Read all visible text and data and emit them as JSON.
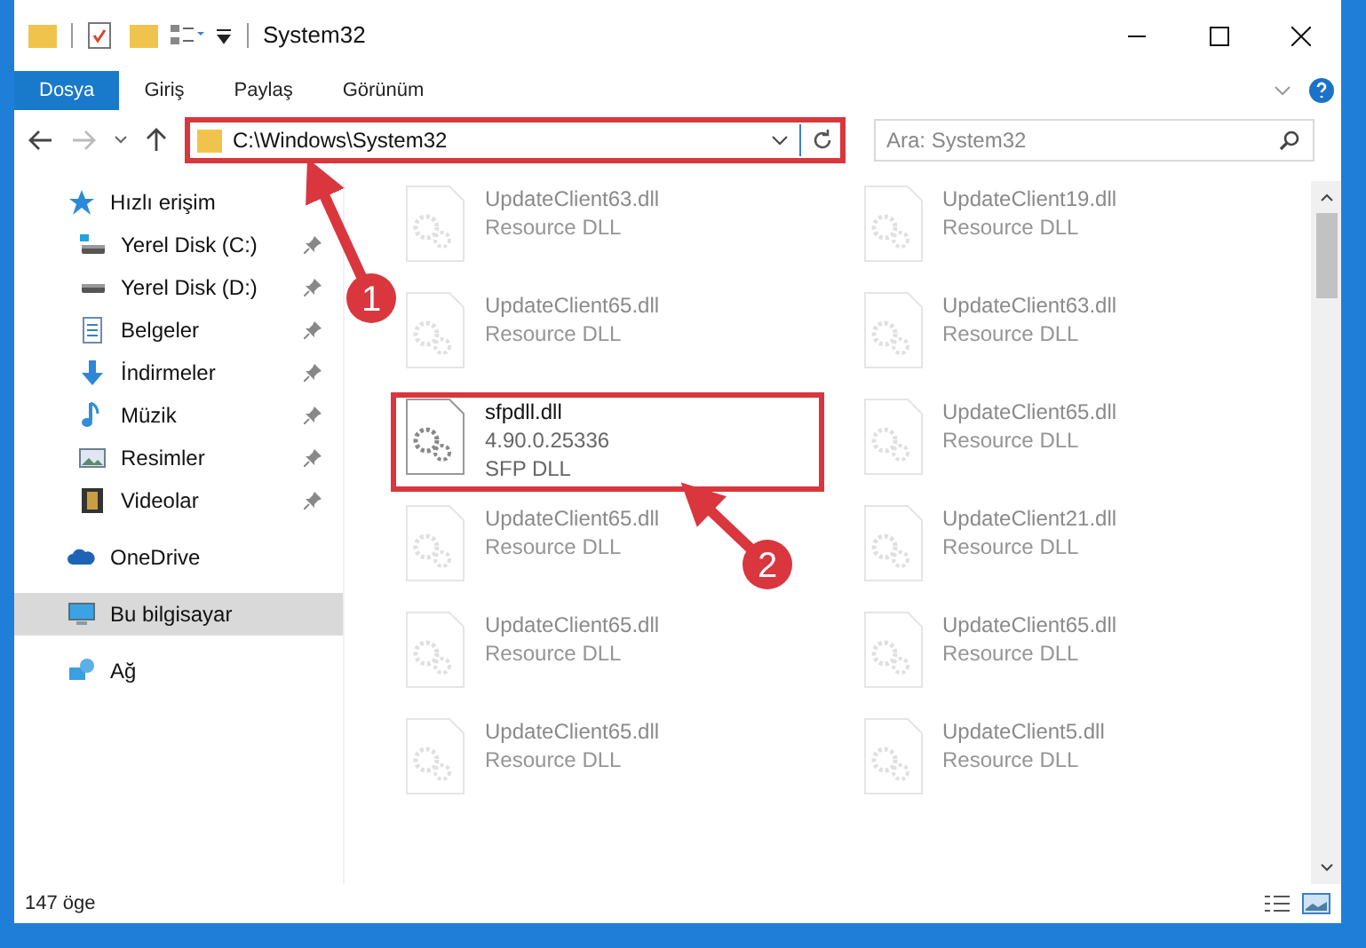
{
  "window": {
    "title": "System32"
  },
  "ribbon": {
    "tabs": [
      {
        "label": "Dosya",
        "selected": true
      },
      {
        "label": "Giriş",
        "selected": false
      },
      {
        "label": "Paylaş",
        "selected": false
      },
      {
        "label": "Görünüm",
        "selected": false
      }
    ]
  },
  "address": {
    "path": "C:\\Windows\\System32",
    "highlighted": true
  },
  "search": {
    "placeholder": "Ara: System32"
  },
  "sidebar": {
    "items": [
      {
        "label": "Hızlı erişim",
        "kind": "quick",
        "selected": false,
        "children": [
          {
            "label": "Yerel Disk (C:)",
            "kind": "drivec",
            "pinned": true,
            "selected": false
          },
          {
            "label": "Yerel Disk (D:)",
            "kind": "drive",
            "pinned": true,
            "selected": false
          },
          {
            "label": "Belgeler",
            "kind": "documents",
            "pinned": true,
            "selected": false
          },
          {
            "label": "İndirmeler",
            "kind": "downloads",
            "pinned": true,
            "selected": false
          },
          {
            "label": "Müzik",
            "kind": "music",
            "pinned": true,
            "selected": false
          },
          {
            "label": "Resimler",
            "kind": "pictures",
            "pinned": true,
            "selected": false
          },
          {
            "label": "Videolar",
            "kind": "videos",
            "pinned": true,
            "selected": false
          }
        ]
      },
      {
        "label": "OneDrive",
        "kind": "cloud",
        "selected": false
      },
      {
        "label": "Bu bilgisayar",
        "kind": "computer",
        "selected": true
      },
      {
        "label": "Ağ",
        "kind": "network",
        "selected": false
      }
    ]
  },
  "files": [
    {
      "name": "UpdateClient63.dll",
      "lines": [
        "Resource DLL"
      ],
      "dimmed": true,
      "highlighted": false
    },
    {
      "name": "UpdateClient19.dll",
      "lines": [
        "Resource DLL"
      ],
      "dimmed": true,
      "highlighted": false
    },
    {
      "name": "UpdateClient65.dll",
      "lines": [
        "Resource DLL"
      ],
      "dimmed": true,
      "highlighted": false
    },
    {
      "name": "UpdateClient63.dll",
      "lines": [
        "Resource DLL"
      ],
      "dimmed": true,
      "highlighted": false
    },
    {
      "name": "sfpdll.dll",
      "lines": [
        "4.90.0.25336",
        "SFP DLL"
      ],
      "dimmed": false,
      "highlighted": true
    },
    {
      "name": "UpdateClient65.dll",
      "lines": [
        "Resource DLL"
      ],
      "dimmed": true,
      "highlighted": false
    },
    {
      "name": "UpdateClient65.dll",
      "lines": [
        "Resource DLL"
      ],
      "dimmed": true,
      "highlighted": false
    },
    {
      "name": "UpdateClient21.dll",
      "lines": [
        "Resource DLL"
      ],
      "dimmed": true,
      "highlighted": false
    },
    {
      "name": "UpdateClient65.dll",
      "lines": [
        "Resource DLL"
      ],
      "dimmed": true,
      "highlighted": false
    },
    {
      "name": "UpdateClient65.dll",
      "lines": [
        "Resource DLL"
      ],
      "dimmed": true,
      "highlighted": false
    },
    {
      "name": "UpdateClient65.dll",
      "lines": [
        "Resource DLL"
      ],
      "dimmed": true,
      "highlighted": false
    },
    {
      "name": "UpdateClient5.dll",
      "lines": [
        "Resource DLL"
      ],
      "dimmed": true,
      "highlighted": false
    }
  ],
  "status_bar": {
    "count": "147 öge"
  },
  "callouts": [
    {
      "label": "1"
    },
    {
      "label": "2"
    }
  ]
}
